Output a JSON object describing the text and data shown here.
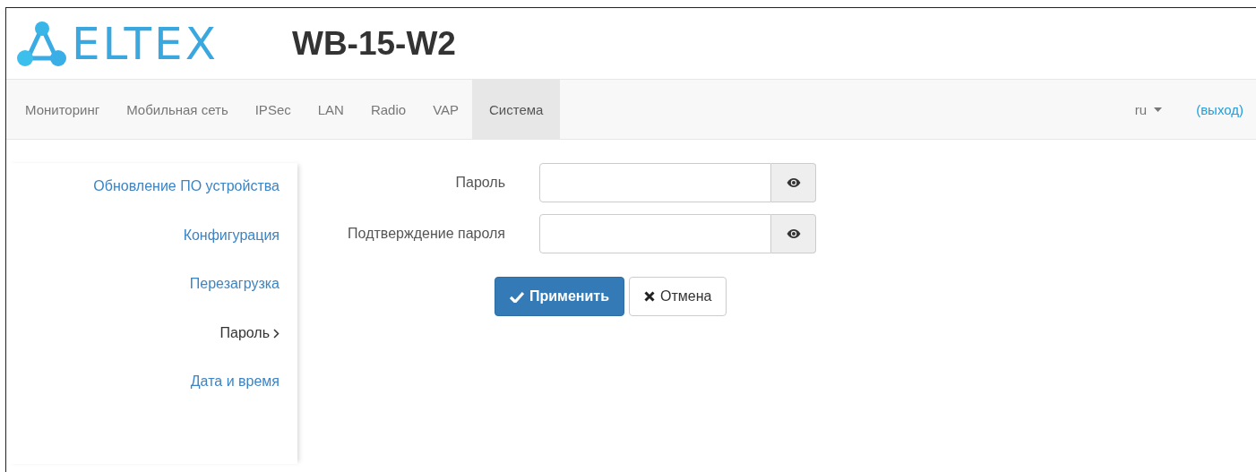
{
  "header": {
    "logo_text": "ELTEX",
    "device": "WB-15-W2"
  },
  "nav": {
    "tabs": [
      {
        "label": "Мониторинг",
        "selected": false
      },
      {
        "label": "Мобильная сеть",
        "selected": false
      },
      {
        "label": "IPSec",
        "selected": false
      },
      {
        "label": "LAN",
        "selected": false
      },
      {
        "label": "Radio",
        "selected": false
      },
      {
        "label": "VAP",
        "selected": false
      },
      {
        "label": "Система",
        "selected": true
      }
    ],
    "language": "ru",
    "logout": "(выход)"
  },
  "sidebar": {
    "items": [
      {
        "label": "Обновление ПО устройства",
        "selected": false
      },
      {
        "label": "Конфигурация",
        "selected": false
      },
      {
        "label": "Перезагрузка",
        "selected": false
      },
      {
        "label": "Пароль",
        "selected": true
      },
      {
        "label": "Дата и время",
        "selected": false
      }
    ]
  },
  "form": {
    "fields": [
      {
        "label": "Пароль"
      },
      {
        "label": "Подтверждение пароля"
      }
    ],
    "buttons": [
      {
        "label": "Применить",
        "kind": "primary"
      },
      {
        "label": "Отмена",
        "kind": "cancel"
      }
    ]
  }
}
